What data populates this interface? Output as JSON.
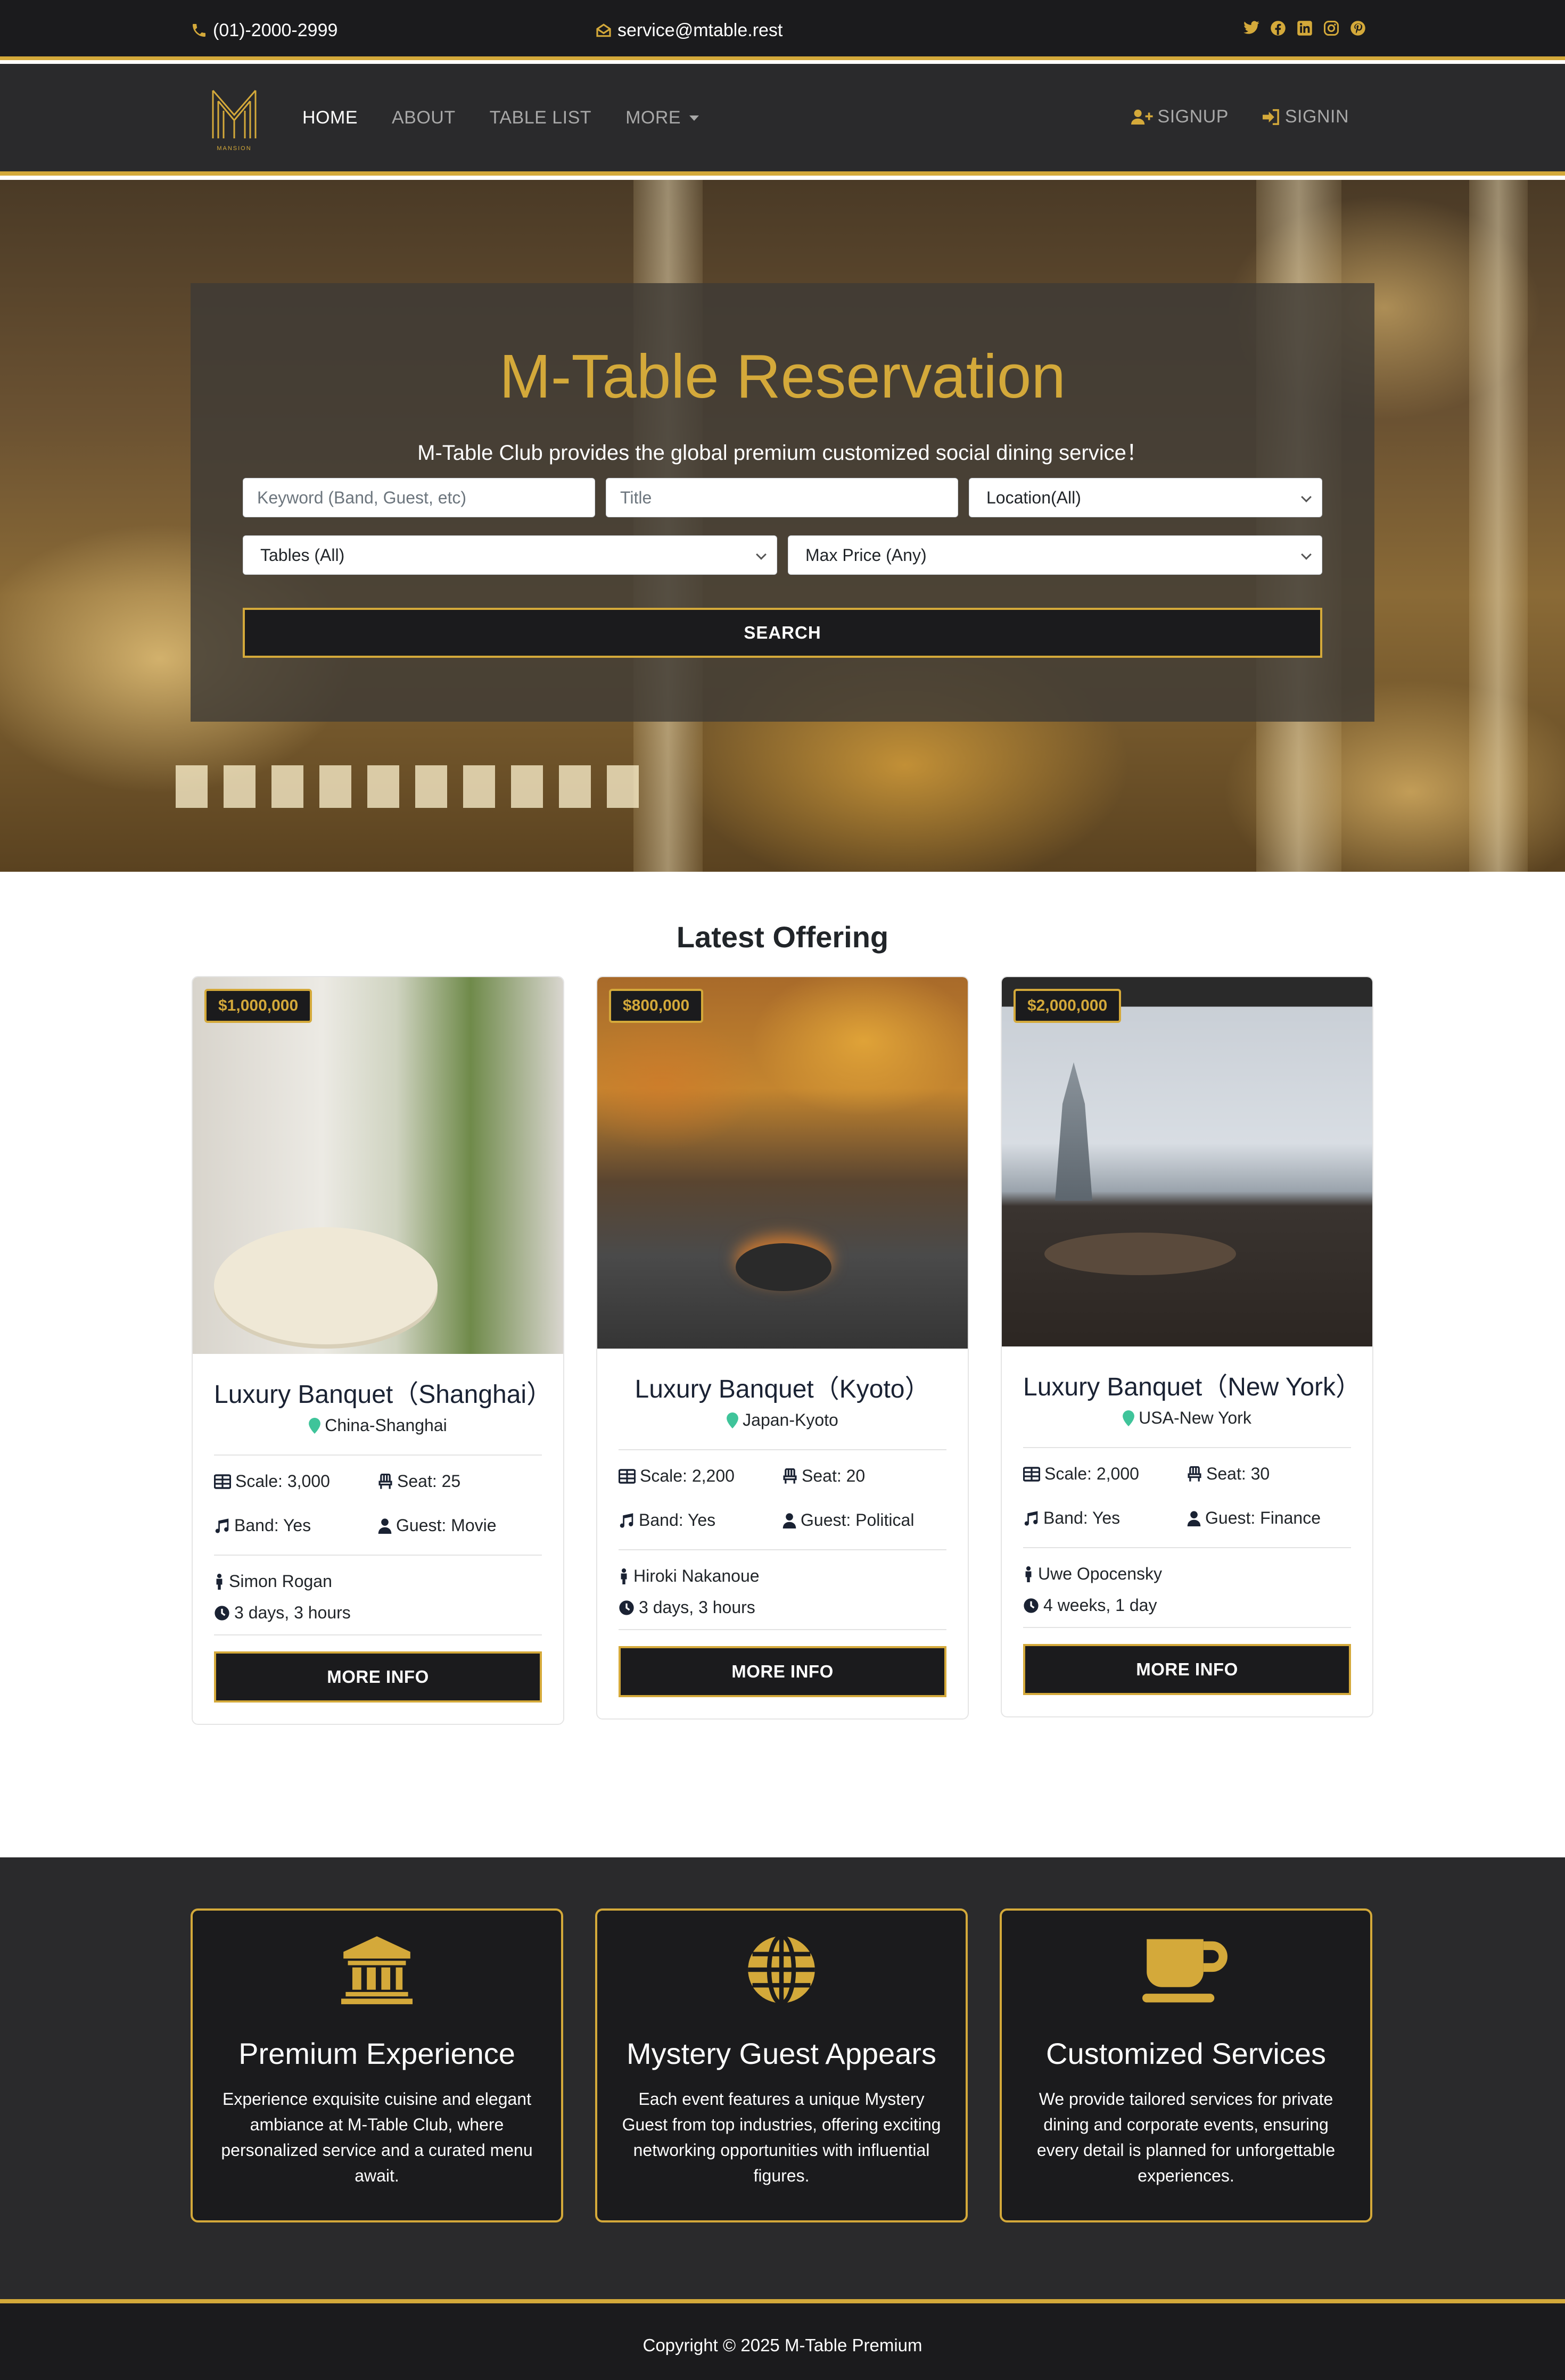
{
  "topbar": {
    "phone": "(01)-2000-2999",
    "email": "service@mtable.rest",
    "social_icons": [
      "twitter-icon",
      "facebook-icon",
      "linkedin-icon",
      "instagram-icon",
      "pinterest-icon"
    ]
  },
  "nav": {
    "brand_text": "MANSION",
    "links": [
      "HOME",
      "ABOUT",
      "TABLE LIST",
      "MORE"
    ],
    "signup": "SIGNUP",
    "signin": "SIGNIN"
  },
  "hero": {
    "title": "M-Table Reservation",
    "subtitle": "M-Table Club provides the global premium customized social dining service！",
    "keyword_placeholder": "Keyword (Band, Guest, etc)",
    "title_placeholder": "Title",
    "location_value": "Location(All)",
    "tables_value": "Tables (All)",
    "price_value": "Max Price (Any)",
    "search_label": "SEARCH"
  },
  "latest": {
    "heading": "Latest Offering",
    "cards": [
      {
        "price": "$1,000,000",
        "title": "Luxury Banquet（Shanghai）",
        "location": "China-Shanghai",
        "scale": "Scale: 3,000",
        "seat": "Seat: 25",
        "band": "Band: Yes",
        "guest": "Guest: Movie",
        "chef": "Simon Rogan",
        "duration": "3 days, 3 hours",
        "button": "MORE INFO"
      },
      {
        "price": "$800,000",
        "title": "Luxury Banquet（Kyoto）",
        "location": "Japan-Kyoto",
        "scale": "Scale: 2,200",
        "seat": "Seat: 20",
        "band": "Band: Yes",
        "guest": "Guest: Political",
        "chef": "Hiroki Nakanoue",
        "duration": "3 days, 3 hours",
        "button": "MORE INFO"
      },
      {
        "price": "$2,000,000",
        "title": "Luxury Banquet（New York）",
        "location": "USA-New York",
        "scale": "Scale: 2,000",
        "seat": "Seat: 30",
        "band": "Band: Yes",
        "guest": "Guest: Finance",
        "chef": "Uwe Opocensky",
        "duration": "4 weeks, 1 day",
        "button": "MORE INFO"
      }
    ]
  },
  "features": [
    {
      "icon": "bank-icon",
      "title": "Premium Experience",
      "text": "Experience exquisite cuisine and elegant ambiance at M-Table Club, where personalized service and a curated menu await."
    },
    {
      "icon": "globe-icon",
      "title": "Mystery Guest Appears",
      "text": "Each event features a unique Mystery Guest from top industries, offering exciting networking opportunities with influential figures."
    },
    {
      "icon": "mug-icon",
      "title": "Customized Services",
      "text": "We provide tailored services for private dining and corporate events, ensuring every detail is planned for unforgettable experiences."
    }
  ],
  "footer": {
    "copyright": "Copyright © 2025 M-Table Premium"
  },
  "colors": {
    "gold": "#d4a93a",
    "dark": "#1b1b1d",
    "nav_bg": "#2a2a2c",
    "location_pin": "#3fc49a"
  }
}
